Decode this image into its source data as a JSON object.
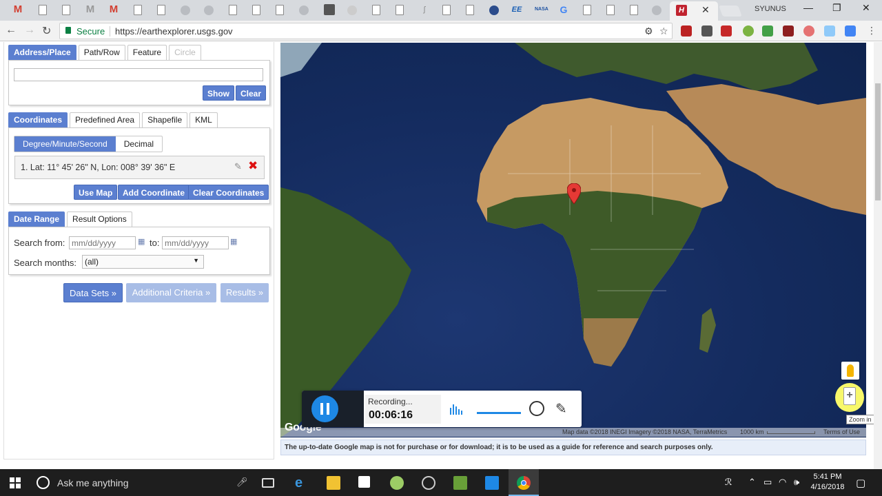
{
  "browser": {
    "user_name": "SYUNUS",
    "secure_label": "Secure",
    "url": "https://earthexplorer.usgs.gov",
    "tab_close": "✕"
  },
  "search": {
    "tabs": [
      "Address/Place",
      "Path/Row",
      "Feature",
      "Circle"
    ],
    "address_value": "",
    "show_label": "Show",
    "clear_label": "Clear"
  },
  "coordinates": {
    "tabs": [
      "Coordinates",
      "Predefined Area",
      "Shapefile",
      "KML"
    ],
    "format_options": [
      "Degree/Minute/Second",
      "Decimal"
    ],
    "entry": "1.  Lat: 11° 45' 26\" N, Lon: 008° 39' 36\" E",
    "use_map_label": "Use Map",
    "add_label": "Add Coordinate",
    "clear_label": "Clear Coordinates"
  },
  "dates": {
    "tabs": [
      "Date Range",
      "Result Options"
    ],
    "from_label": "Search from:",
    "to_label": "to:",
    "from_placeholder": "mm/dd/yyyy",
    "to_placeholder": "mm/dd/yyyy",
    "months_label": "Search months:",
    "months_value": "(all)"
  },
  "steps": {
    "data_sets": "Data Sets »",
    "additional": "Additional Criteria »",
    "results": "Results »"
  },
  "map": {
    "attribution": "Map data ©2018 INEGI Imagery ©2018 NASA, TerraMetrics",
    "scale": "1000 km",
    "terms": "Terms of Use",
    "logo": "Google",
    "zoom_tooltip": "Zoom in",
    "disclaimer": "The up-to-date Google map is not for purchase or for download; it is to be used as a guide for reference and search purposes only."
  },
  "recorder": {
    "status": "Recording...",
    "time": "00:06:16"
  },
  "taskbar": {
    "search_placeholder": "Ask me anything",
    "time": "5:41 PM",
    "date": "4/16/2018"
  }
}
